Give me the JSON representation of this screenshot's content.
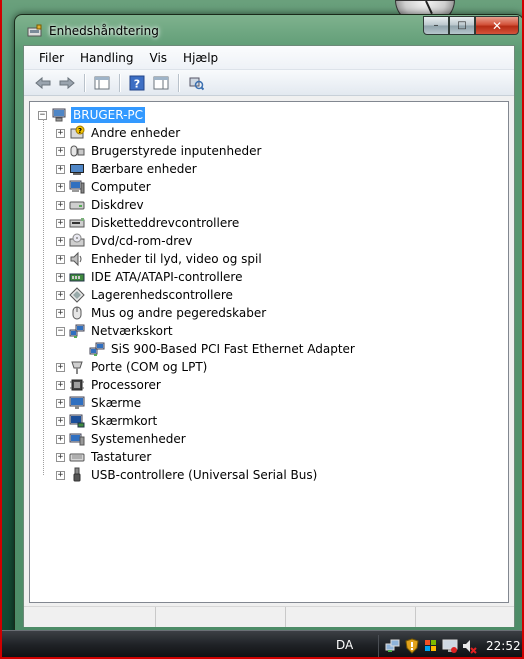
{
  "window": {
    "title": "Enhedshåndtering",
    "controls": {
      "minimize": "–",
      "maximize": "□",
      "close": "✕"
    }
  },
  "menubar": {
    "items": [
      "Filer",
      "Handling",
      "Vis",
      "Hjælp"
    ]
  },
  "toolbar": {
    "buttons": [
      {
        "icon": "back-arrow-icon"
      },
      {
        "icon": "forward-arrow-icon"
      },
      {
        "icon": "properties-pane-icon"
      },
      {
        "icon": "help-icon"
      },
      {
        "icon": "view-pane-icon"
      },
      {
        "icon": "scan-hardware-icon"
      }
    ]
  },
  "tree": {
    "root": {
      "label": "BRUGER-PC",
      "expanded": true,
      "selected": true
    },
    "categories": [
      {
        "label": "Andre enheder",
        "icon": "unknown-device-icon",
        "expanded": false
      },
      {
        "label": "Brugerstyrede inputenheder",
        "icon": "hid-icon",
        "expanded": false
      },
      {
        "label": "Bærbare enheder",
        "icon": "portable-device-icon",
        "expanded": false
      },
      {
        "label": "Computer",
        "icon": "computer-icon",
        "expanded": false
      },
      {
        "label": "Diskdrev",
        "icon": "disk-drive-icon",
        "expanded": false
      },
      {
        "label": "Disketteddrevcontrollere",
        "icon": "floppy-controller-icon",
        "expanded": false
      },
      {
        "label": "Dvd/cd-rom-drev",
        "icon": "dvd-drive-icon",
        "expanded": false
      },
      {
        "label": "Enheder til lyd, video og spil",
        "icon": "sound-icon",
        "expanded": false
      },
      {
        "label": "IDE ATA/ATAPI-controllere",
        "icon": "ide-controller-icon",
        "expanded": false
      },
      {
        "label": "Lagerenhedscontrollere",
        "icon": "storage-controller-icon",
        "expanded": false
      },
      {
        "label": "Mus og andre pegeredskaber",
        "icon": "mouse-icon",
        "expanded": false
      },
      {
        "label": "Netværkskort",
        "icon": "network-adapter-icon",
        "expanded": true,
        "children": [
          {
            "label": "SiS 900-Based PCI Fast Ethernet Adapter",
            "icon": "network-adapter-icon"
          }
        ]
      },
      {
        "label": "Porte (COM og LPT)",
        "icon": "port-icon",
        "expanded": false
      },
      {
        "label": "Processorer",
        "icon": "processor-icon",
        "expanded": false
      },
      {
        "label": "Skærme",
        "icon": "monitor-icon",
        "expanded": false
      },
      {
        "label": "Skærmkort",
        "icon": "display-adapter-icon",
        "expanded": false
      },
      {
        "label": "Systemenheder",
        "icon": "system-device-icon",
        "expanded": false
      },
      {
        "label": "Tastaturer",
        "icon": "keyboard-icon",
        "expanded": false
      },
      {
        "label": "USB-controllere (Universal Serial Bus)",
        "icon": "usb-icon",
        "expanded": false
      }
    ]
  },
  "taskbar": {
    "language": "DA",
    "time": "22:52",
    "tray_icons": [
      "network-icon",
      "security-shield-icon",
      "windows-update-icon",
      "display-icon",
      "volume-muted-icon"
    ]
  }
}
